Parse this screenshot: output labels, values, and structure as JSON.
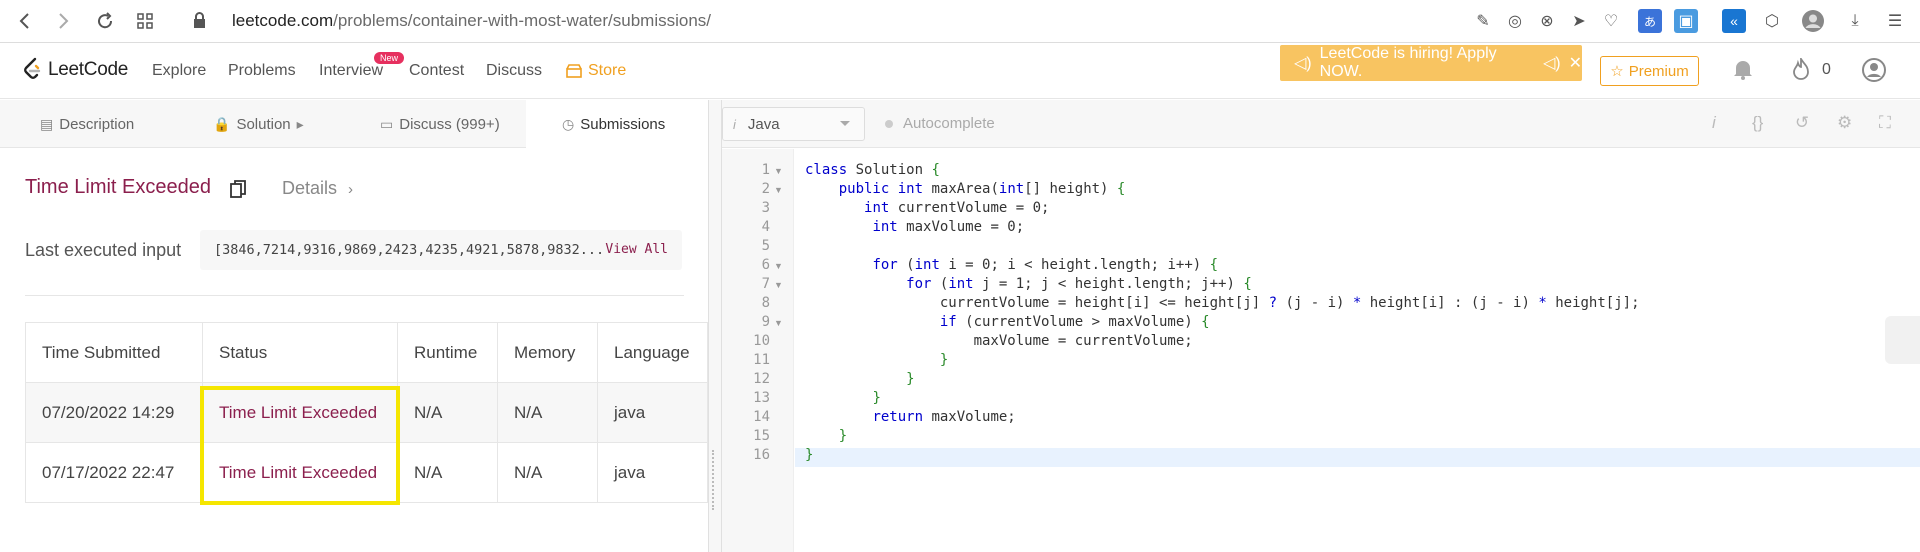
{
  "browser": {
    "url_host": "leetcode.com",
    "url_path": "/problems/container-with-most-water/submissions/"
  },
  "nav": {
    "logo": "LeetCode",
    "links": [
      "Explore",
      "Problems",
      "Interview",
      "Contest",
      "Discuss",
      "Store"
    ],
    "new_badge": "New",
    "hiring": "LeetCode is hiring! Apply NOW.",
    "premium": "Premium",
    "flame_count": "0"
  },
  "tabs": [
    {
      "label": "Description",
      "icon": "description-icon"
    },
    {
      "label": "Solution",
      "icon": "lock-icon"
    },
    {
      "label": "Discuss (999+)",
      "icon": "discuss-icon"
    },
    {
      "label": "Submissions",
      "icon": "clock-icon"
    }
  ],
  "result": {
    "status": "Time Limit Exceeded",
    "details": "Details",
    "last_input_label": "Last executed input",
    "last_input_value": "[3846,7214,9316,9869,2423,4235,4921,5878,9832...",
    "view_all": "View All"
  },
  "table": {
    "headers": [
      "Time Submitted",
      "Status",
      "Runtime",
      "Memory",
      "Language"
    ],
    "rows": [
      [
        "07/20/2022 14:29",
        "Time Limit Exceeded",
        "N/A",
        "N/A",
        "java"
      ],
      [
        "07/17/2022 22:47",
        "Time Limit Exceeded",
        "N/A",
        "N/A",
        "java"
      ]
    ]
  },
  "editor": {
    "language": "Java",
    "autocomplete": "Autocomplete",
    "line_numbers": [
      "1",
      "2",
      "3",
      "4",
      "5",
      "6",
      "7",
      "8",
      "9",
      "10",
      "11",
      "12",
      "13",
      "14",
      "15",
      "16"
    ]
  },
  "colors": {
    "brand_status": "#8b1f4d",
    "premium": "#f0a020",
    "hiring_bg": "#f8c461",
    "highlight": "#f5e600"
  }
}
